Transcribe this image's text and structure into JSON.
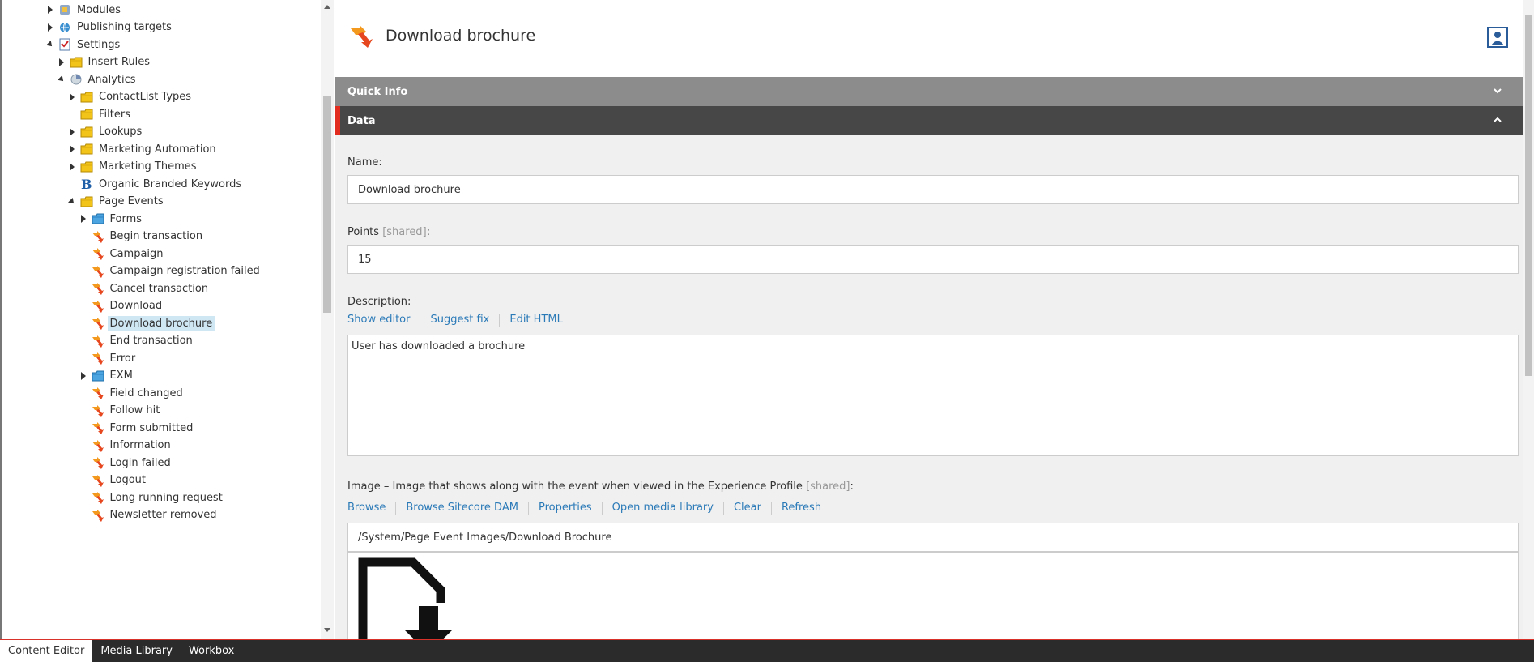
{
  "tree": {
    "items": [
      {
        "label": "Modules",
        "toggle": "collapsed",
        "icon": "module-icon",
        "depth": 0
      },
      {
        "label": "Publishing targets",
        "toggle": "collapsed",
        "icon": "globe-icon",
        "depth": 0
      },
      {
        "label": "Settings",
        "toggle": "expanded",
        "icon": "settings-checklist-icon",
        "depth": 0
      },
      {
        "label": "Insert Rules",
        "toggle": "collapsed",
        "icon": "folder-icon",
        "depth": 1
      },
      {
        "label": "Analytics",
        "toggle": "expanded",
        "icon": "analytics-icon",
        "depth": 1
      },
      {
        "label": "ContactList Types",
        "toggle": "collapsed",
        "icon": "folder-icon",
        "depth": 2
      },
      {
        "label": "Filters",
        "toggle": "none",
        "icon": "folder-icon",
        "depth": 2
      },
      {
        "label": "Lookups",
        "toggle": "collapsed",
        "icon": "folder-icon",
        "depth": 2
      },
      {
        "label": "Marketing Automation",
        "toggle": "collapsed",
        "icon": "folder-icon",
        "depth": 2
      },
      {
        "label": "Marketing Themes",
        "toggle": "collapsed",
        "icon": "folder-icon",
        "depth": 2
      },
      {
        "label": "Organic Branded Keywords",
        "toggle": "none",
        "icon": "bold-b-icon",
        "depth": 2
      },
      {
        "label": "Page Events",
        "toggle": "expanded",
        "icon": "folder-icon",
        "depth": 2
      },
      {
        "label": "Forms",
        "toggle": "collapsed",
        "icon": "blue-folder-icon",
        "depth": 3
      },
      {
        "label": "Begin transaction",
        "toggle": "none",
        "icon": "page-event-icon",
        "depth": 3
      },
      {
        "label": "Campaign",
        "toggle": "none",
        "icon": "page-event-icon",
        "depth": 3
      },
      {
        "label": "Campaign registration failed",
        "toggle": "none",
        "icon": "page-event-icon",
        "depth": 3
      },
      {
        "label": "Cancel transaction",
        "toggle": "none",
        "icon": "page-event-icon",
        "depth": 3
      },
      {
        "label": "Download",
        "toggle": "none",
        "icon": "page-event-icon",
        "depth": 3
      },
      {
        "label": "Download brochure",
        "toggle": "none",
        "icon": "page-event-icon",
        "depth": 3,
        "selected": true
      },
      {
        "label": "End transaction",
        "toggle": "none",
        "icon": "page-event-icon",
        "depth": 3
      },
      {
        "label": "Error",
        "toggle": "none",
        "icon": "page-event-icon",
        "depth": 3
      },
      {
        "label": "EXM",
        "toggle": "collapsed",
        "icon": "blue-folder-icon",
        "depth": 3
      },
      {
        "label": "Field changed",
        "toggle": "none",
        "icon": "page-event-icon",
        "depth": 3
      },
      {
        "label": "Follow hit",
        "toggle": "none",
        "icon": "page-event-icon",
        "depth": 3
      },
      {
        "label": "Form submitted",
        "toggle": "none",
        "icon": "page-event-icon",
        "depth": 3
      },
      {
        "label": "Information",
        "toggle": "none",
        "icon": "page-event-icon",
        "depth": 3
      },
      {
        "label": "Login failed",
        "toggle": "none",
        "icon": "page-event-icon",
        "depth": 3
      },
      {
        "label": "Logout",
        "toggle": "none",
        "icon": "page-event-icon",
        "depth": 3
      },
      {
        "label": "Long running request",
        "toggle": "none",
        "icon": "page-event-icon",
        "depth": 3
      },
      {
        "label": "Newsletter removed",
        "toggle": "none",
        "icon": "page-event-icon",
        "depth": 3
      }
    ]
  },
  "editor": {
    "title": "Download brochure",
    "sections": {
      "quick_info": "Quick Info",
      "data": "Data"
    },
    "fields": {
      "name_label": "Name:",
      "name_value": "Download brochure",
      "points_label": "Points",
      "points_shared": "[shared]",
      "points_colon": ":",
      "points_value": "15",
      "description_label": "Description:",
      "description_links": [
        "Show editor",
        "Suggest fix",
        "Edit HTML"
      ],
      "description_value": "User has downloaded a brochure",
      "image_label": "Image – Image that shows along with the event when viewed in the Experience Profile",
      "image_shared": "[shared]",
      "image_colon": ":",
      "image_links": [
        "Browse",
        "Browse Sitecore DAM",
        "Properties",
        "Open media library",
        "Clear",
        "Refresh"
      ],
      "image_path": "/System/Page Event Images/Download Brochure"
    }
  },
  "taskbar": {
    "tabs": [
      "Content Editor",
      "Media Library",
      "Workbox"
    ],
    "active": "Content Editor"
  },
  "colors": {
    "accent_red": "#e12c1f",
    "link_blue": "#2b7ab8",
    "quick_info_bar": "#8c8c8c",
    "data_bar": "#474747",
    "selected_bg": "#cfe6f3",
    "taskbar_bg": "#2b2b2b"
  }
}
